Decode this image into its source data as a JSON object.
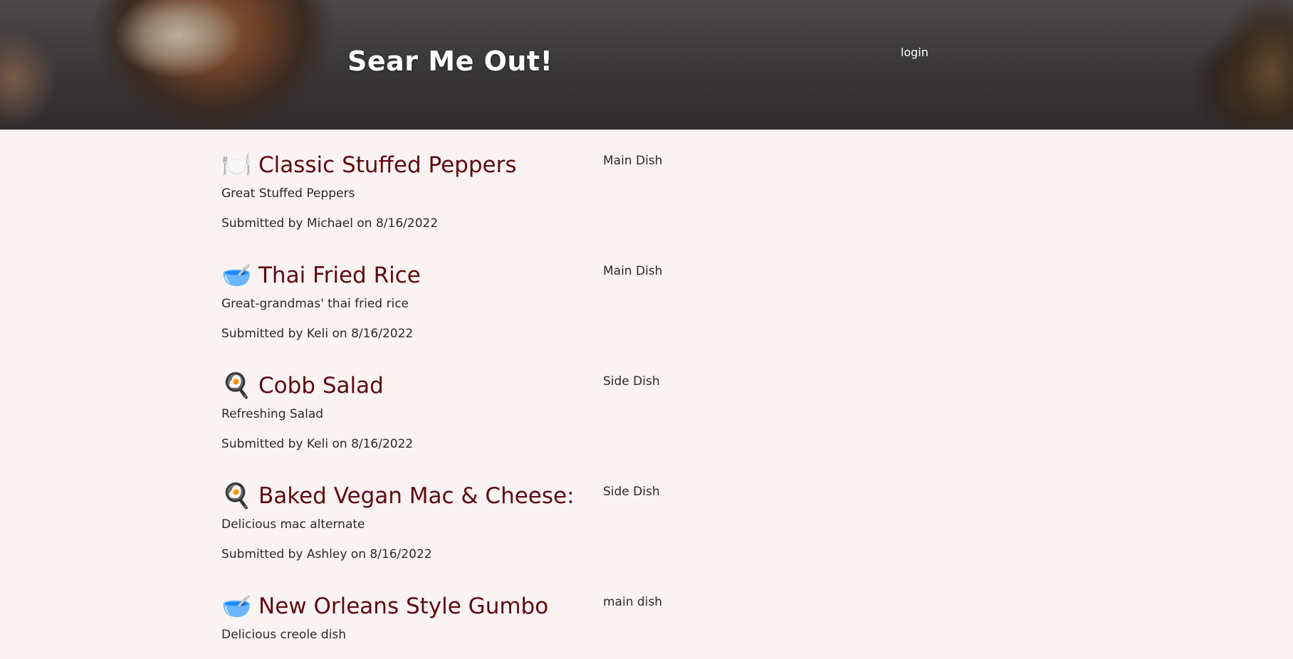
{
  "header": {
    "title": "Sear Me Out!",
    "login_label": "login"
  },
  "recipes": [
    {
      "icon": "🍽️",
      "icon_name": "plate-utensils-icon",
      "title": "Classic Stuffed Peppers",
      "category": "Main Dish",
      "description": "Great Stuffed Peppers",
      "submitted": "Submitted by Michael on 8/16/2022"
    },
    {
      "icon": "🥣",
      "icon_name": "bowl-icon",
      "title": "Thai Fried Rice",
      "category": "Main Dish",
      "description": "Great-grandmas' thai fried rice",
      "submitted": "Submitted by Keli on 8/16/2022"
    },
    {
      "icon": "🍳",
      "icon_name": "frying-pan-egg-icon",
      "title": "Cobb Salad",
      "category": "Side Dish",
      "description": "Refreshing Salad",
      "submitted": "Submitted by Keli on 8/16/2022"
    },
    {
      "icon": "🍳",
      "icon_name": "frying-pan-egg-icon",
      "title": "Baked Vegan Mac & Cheese:",
      "category": "Side Dish",
      "description": "Delicious mac alternate",
      "submitted": "Submitted by Ashley on 8/16/2022"
    },
    {
      "icon": "🥣",
      "icon_name": "bowl-icon",
      "title": "New Orleans Style Gumbo",
      "category": "main dish",
      "description": "Delicious creole dish",
      "submitted": ""
    }
  ],
  "colors": {
    "background": "#f9f3f2",
    "title_color": "#5e0a0e",
    "text_color": "#2a2a2a"
  }
}
